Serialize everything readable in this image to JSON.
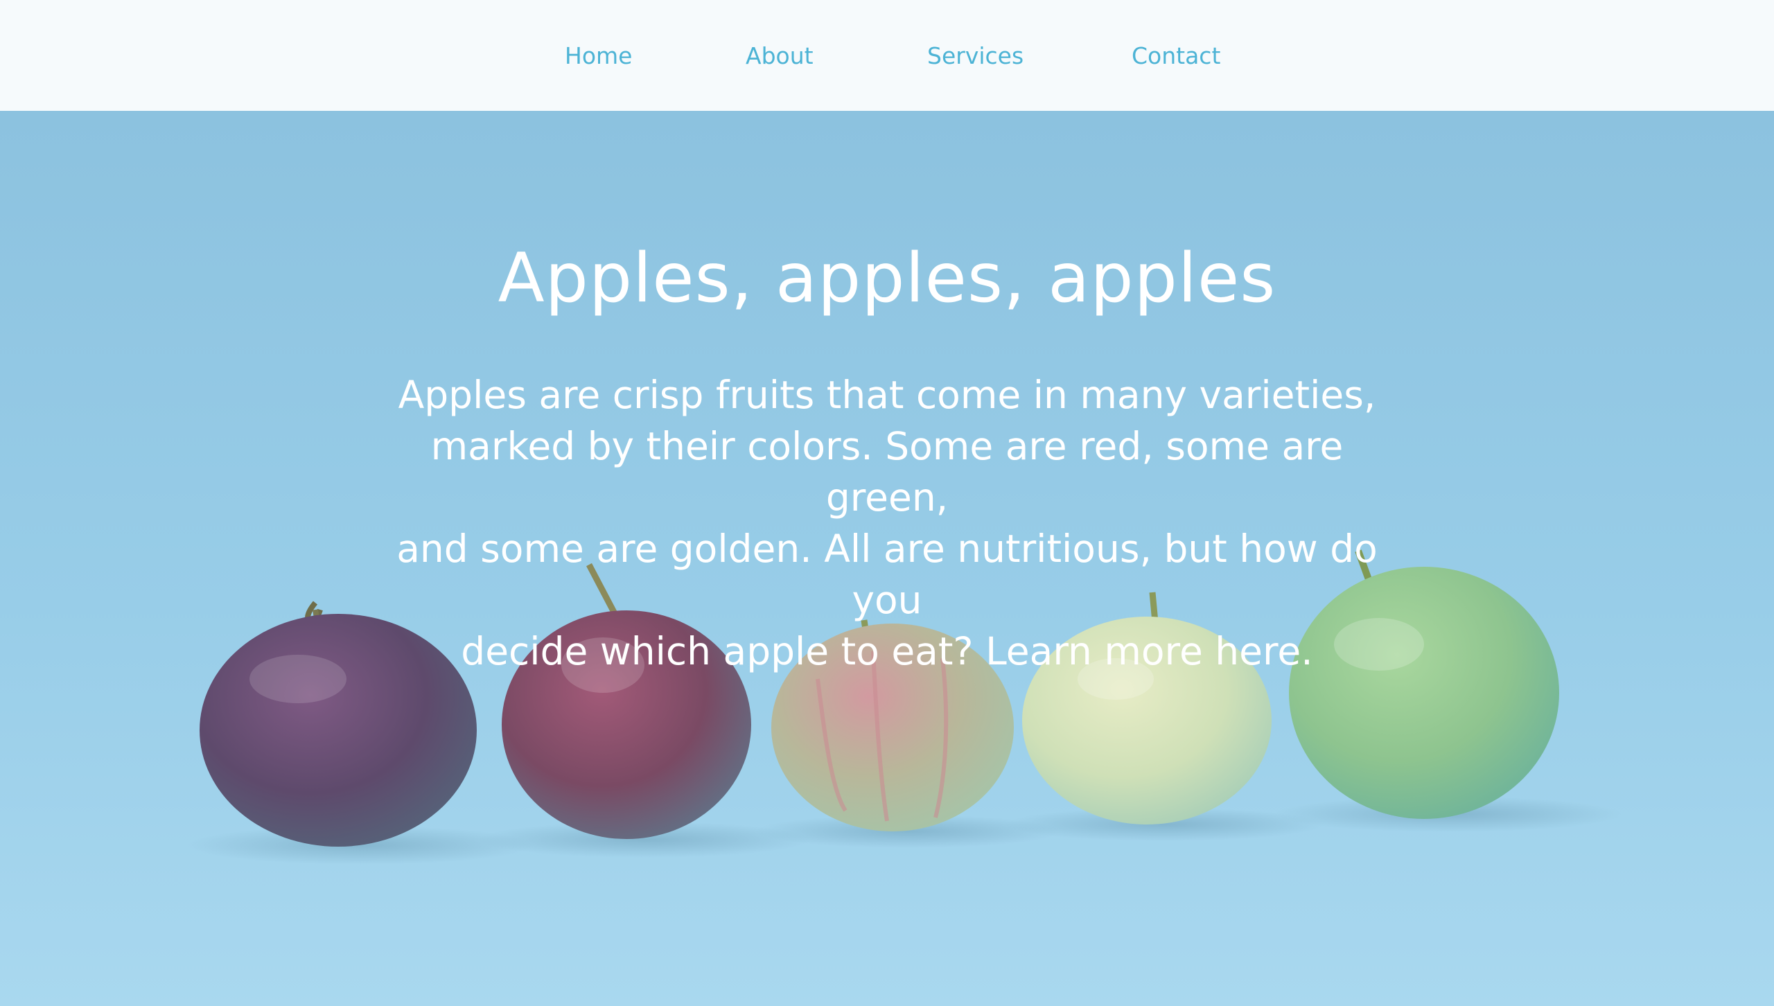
{
  "nav": {
    "items": [
      {
        "label": "Home"
      },
      {
        "label": "About"
      },
      {
        "label": "Services"
      },
      {
        "label": "Contact"
      }
    ]
  },
  "hero": {
    "title": "Apples, apples, apples",
    "body_line_1": "Apples are crisp fruits that come in many varieties,",
    "body_line_2": "marked by their colors. Some are red, some are green,",
    "body_line_3": "and some are golden. All are nutritious, but how do you",
    "body_line_4_prefix": "decide which apple to eat? ",
    "body_link": "Learn more here."
  },
  "colors": {
    "nav_background": "#f6fafc",
    "nav_link": "#4cb3d5",
    "hero_background": "#98cde8",
    "hero_text": "#ffffff"
  },
  "apples": [
    {
      "name": "dark-red-apple",
      "color": "#5e4a6c"
    },
    {
      "name": "red-apple",
      "color": "#7a4a64"
    },
    {
      "name": "striped-red-apple",
      "color": "#b8b79a"
    },
    {
      "name": "yellow-apple",
      "color": "#cfe0b7"
    },
    {
      "name": "green-apple",
      "color": "#8ec48f"
    }
  ]
}
